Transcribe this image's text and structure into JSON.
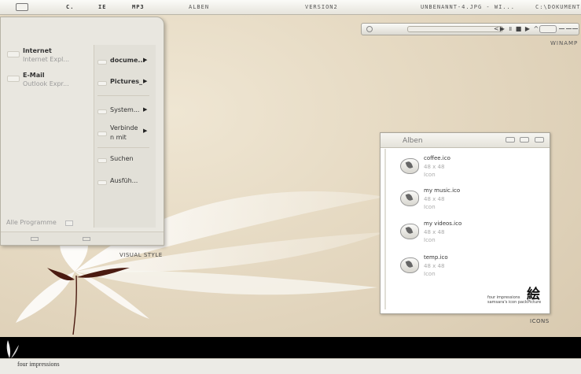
{
  "topbar": {
    "items": [
      "C.",
      "IE",
      "MP3",
      "ALBEN",
      "VERSION2",
      "UNBENANNT-4.JPG - WI...",
      "C:\\DOKUMENT"
    ]
  },
  "winamp": {
    "label": "WINAMP",
    "controls": "<▶ ॥ ■ ▶ ^"
  },
  "start_menu": {
    "pinned": [
      {
        "title": "Internet",
        "subtitle": "Internet Expl..."
      },
      {
        "title": "E-Mail",
        "subtitle": "Outlook Expr..."
      }
    ],
    "right_items": [
      {
        "label": "docume..."
      },
      {
        "label": "Pictures_"
      },
      {
        "label": "System..."
      },
      {
        "label": "Verbinde\nn mit"
      },
      {
        "label": "Suchen"
      },
      {
        "label": "Ausfüh..."
      }
    ],
    "all_programs": "Alle Programme"
  },
  "desktop_labels": {
    "visual_style": "VISUAL STYLE",
    "icons": "ICONS"
  },
  "alben_window": {
    "title": "Alben",
    "files": [
      {
        "name": "coffee.ico",
        "dims": "48 x 48",
        "type": "Icon"
      },
      {
        "name": "my music.ico",
        "dims": "48 x 48",
        "type": "Icon"
      },
      {
        "name": "my videos.ico",
        "dims": "48 x 48",
        "type": "Icon"
      },
      {
        "name": "temp.ico",
        "dims": "48 x 48",
        "type": "Icon"
      }
    ],
    "pack_line1": "four impressions",
    "pack_line2": "samsara's icon pack",
    "kanji": "絵",
    "kanji_sub": "Picture"
  },
  "bottom": {
    "brand": "four impressions"
  }
}
